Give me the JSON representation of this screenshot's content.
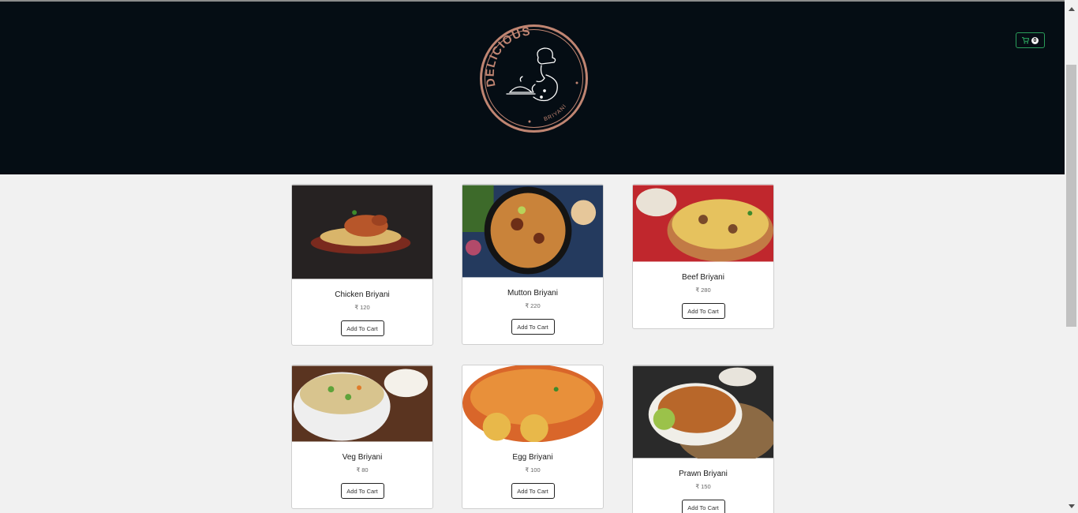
{
  "brand": {
    "logo_top_text": "DELICIOUS",
    "logo_bottom_text": "BRIYANI",
    "colors": {
      "header_bg": "#050d14",
      "logo_ring": "#c08572",
      "cart_border": "#2a9d5a"
    }
  },
  "cart": {
    "icon": "shopping-cart-icon",
    "count": "0"
  },
  "currency_symbol": "₹",
  "add_label": "Add To Cart",
  "products": [
    {
      "name": "Chicken Briyani",
      "price": "120"
    },
    {
      "name": "Mutton Briyani",
      "price": "220"
    },
    {
      "name": "Beef Briyani",
      "price": "280"
    },
    {
      "name": "Veg Briyani",
      "price": "80"
    },
    {
      "name": "Egg Briyani",
      "price": "100"
    },
    {
      "name": "Prawn Briyani",
      "price": "150"
    }
  ]
}
